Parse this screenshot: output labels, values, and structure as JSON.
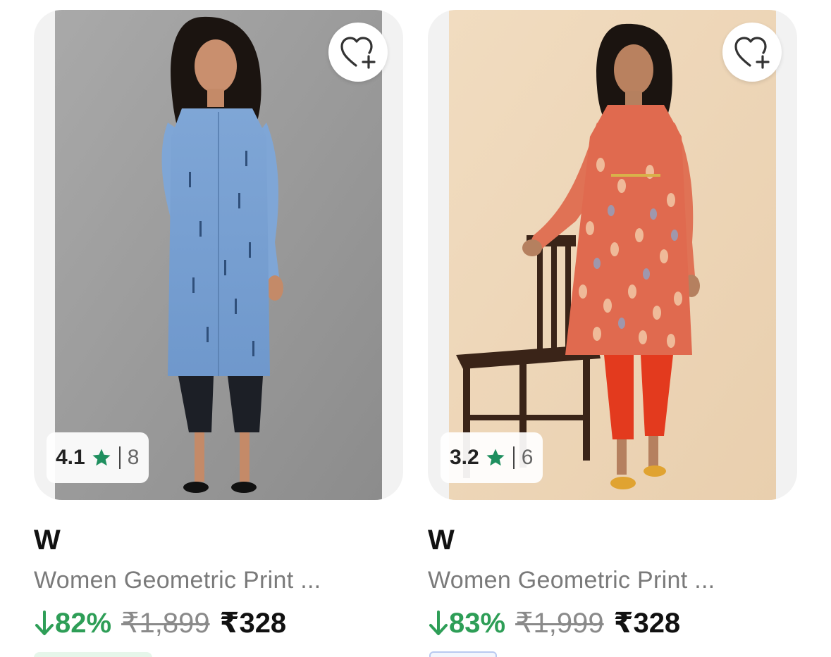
{
  "products": [
    {
      "brand": "W",
      "title": "Women Geometric Print ...",
      "rating": "4.1",
      "rating_count": "8",
      "discount": "82%",
      "mrp": "₹1,899",
      "price": "₹328"
    },
    {
      "brand": "W",
      "title": "Women Geometric Print ...",
      "rating": "3.2",
      "rating_count": "6",
      "discount": "83%",
      "mrp": "₹1,999",
      "price": "₹328"
    }
  ],
  "icons": {
    "wishlist": "heart-plus-icon",
    "rating_star": "star-icon",
    "discount_arrow": "arrow-down-icon"
  },
  "colors": {
    "discount_green": "#2e9e57",
    "star_green": "#1f8f5f",
    "card_bg": "#f2f2f2"
  }
}
